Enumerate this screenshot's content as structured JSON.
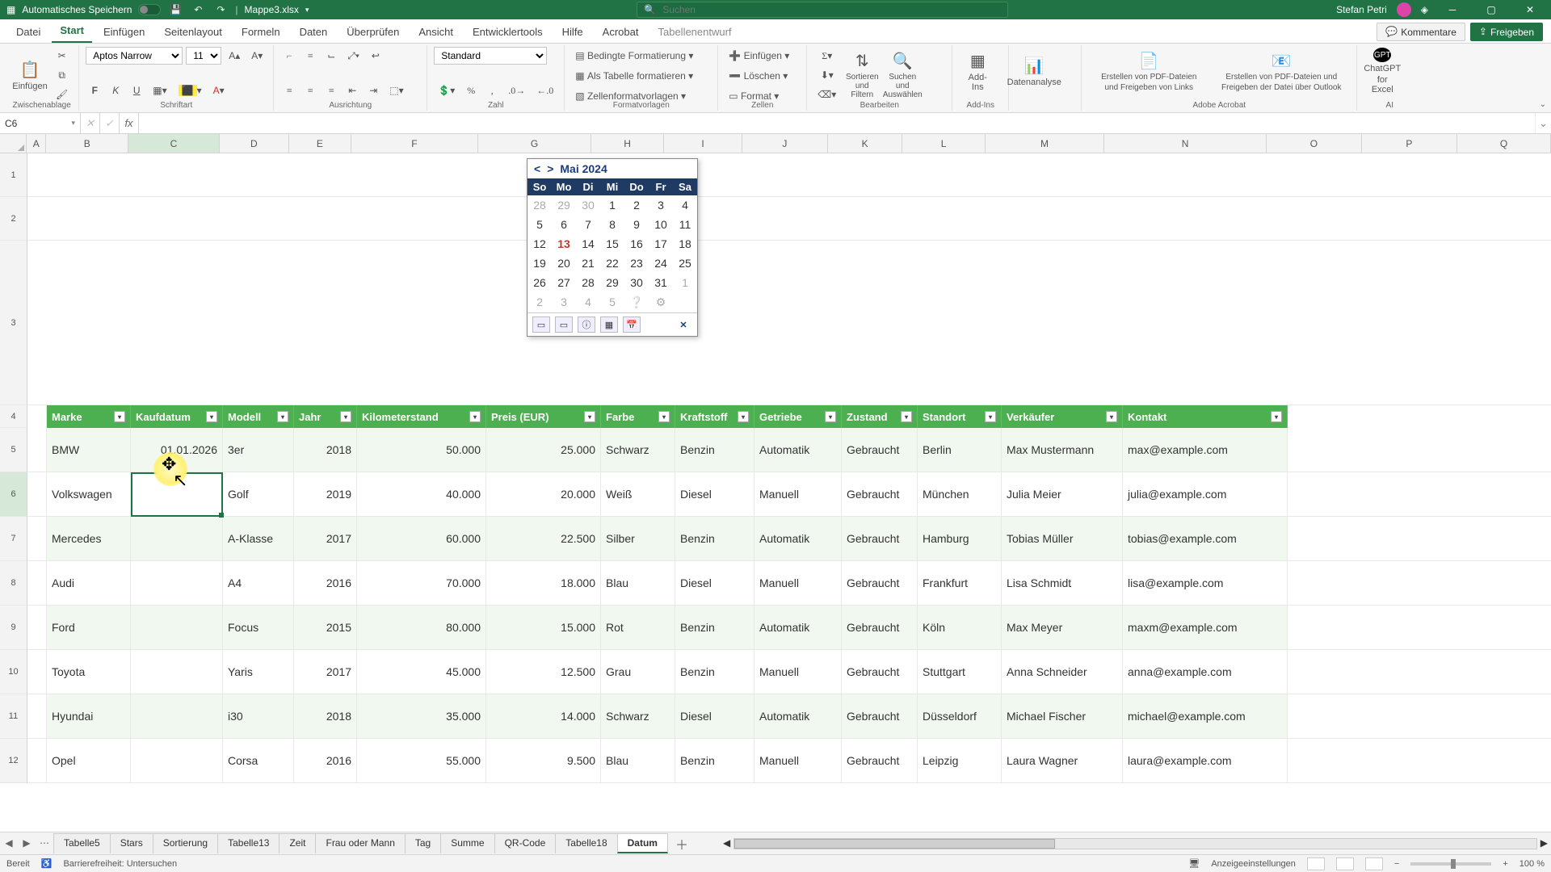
{
  "titlebar": {
    "autosave_label": "Automatisches Speichern",
    "filename": "Mappe3.xlsx",
    "search_placeholder": "Suchen",
    "user_name": "Stefan Petri"
  },
  "tabs": {
    "items": [
      "Datei",
      "Start",
      "Einfügen",
      "Seitenlayout",
      "Formeln",
      "Daten",
      "Überprüfen",
      "Ansicht",
      "Entwicklertools",
      "Hilfe",
      "Acrobat",
      "Tabellenentwurf"
    ],
    "active_index": 1,
    "comments": "Kommentare",
    "share": "Freigeben"
  },
  "ribbon": {
    "clipboard": {
      "paste": "Einfügen",
      "group": "Zwischenablage"
    },
    "font": {
      "name": "Aptos Narrow",
      "size": "11",
      "group": "Schriftart"
    },
    "alignment": {
      "group": "Ausrichtung"
    },
    "number": {
      "format": "Standard",
      "group": "Zahl"
    },
    "styles": {
      "cond": "Bedingte Formatierung",
      "astable": "Als Tabelle formatieren",
      "cellstyles": "Zellenformatvorlagen",
      "group": "Formatvorlagen"
    },
    "cells": {
      "insert": "Einfügen",
      "delete": "Löschen",
      "format": "Format",
      "group": "Zellen"
    },
    "editing": {
      "sort": "Sortieren und Filtern",
      "find": "Suchen und Auswählen",
      "group": "Bearbeiten"
    },
    "addins": {
      "btn": "Add-Ins",
      "group": "Add-Ins"
    },
    "analysis": {
      "btn": "Datenanalyse"
    },
    "acrobat": {
      "btn1a": "Erstellen von PDF-Dateien",
      "btn1b": "und Freigeben von Links",
      "btn2a": "Erstellen von PDF-Dateien und",
      "btn2b": "Freigeben der Datei über Outlook",
      "group": "Adobe Acrobat"
    },
    "ai": {
      "btn1": "ChatGPT",
      "btn2": "for Excel",
      "group": "AI"
    }
  },
  "namebox": "C6",
  "columns": [
    "A",
    "B",
    "C",
    "D",
    "E",
    "F",
    "G",
    "H",
    "I",
    "J",
    "K",
    "L",
    "M",
    "N",
    "O",
    "P",
    "Q"
  ],
  "row_numbers": [
    "1",
    "2",
    "3",
    "4",
    "5",
    "6",
    "7",
    "8",
    "9",
    "10",
    "11",
    "12"
  ],
  "calendar": {
    "title": "Mai 2024",
    "dow": [
      "So",
      "Mo",
      "Di",
      "Mi",
      "Do",
      "Fr",
      "Sa"
    ],
    "leading": [
      "28",
      "29",
      "30"
    ],
    "days": [
      "1",
      "2",
      "3",
      "4",
      "5",
      "6",
      "7",
      "8",
      "9",
      "10",
      "11",
      "12",
      "13",
      "14",
      "15",
      "16",
      "17",
      "18",
      "19",
      "20",
      "21",
      "22",
      "23",
      "24",
      "25",
      "26",
      "27",
      "28",
      "29",
      "30",
      "31"
    ],
    "trailing": [
      "1",
      "2",
      "3",
      "4",
      "5"
    ],
    "today": "13"
  },
  "table": {
    "headers": [
      "Marke",
      "Kaufdatum",
      "Modell",
      "Jahr",
      "Kilometerstand",
      "Preis (EUR)",
      "Farbe",
      "Kraftstoff",
      "Getriebe",
      "Zustand",
      "Standort",
      "Verkäufer",
      "Kontakt"
    ],
    "rows": [
      {
        "marke": "BMW",
        "kauf": "01.01.2026",
        "modell": "3er",
        "jahr": "2018",
        "km": "50.000",
        "preis": "25.000",
        "farbe": "Schwarz",
        "kraft": "Benzin",
        "getr": "Automatik",
        "zust": "Gebraucht",
        "ort": "Berlin",
        "verk": "Max Mustermann",
        "kontakt": "max@example.com"
      },
      {
        "marke": "Volkswagen",
        "kauf": "",
        "modell": "Golf",
        "jahr": "2019",
        "km": "40.000",
        "preis": "20.000",
        "farbe": "Weiß",
        "kraft": "Diesel",
        "getr": "Manuell",
        "zust": "Gebraucht",
        "ort": "München",
        "verk": "Julia Meier",
        "kontakt": "julia@example.com"
      },
      {
        "marke": "Mercedes",
        "kauf": "",
        "modell": "A-Klasse",
        "jahr": "2017",
        "km": "60.000",
        "preis": "22.500",
        "farbe": "Silber",
        "kraft": "Benzin",
        "getr": "Automatik",
        "zust": "Gebraucht",
        "ort": "Hamburg",
        "verk": "Tobias Müller",
        "kontakt": "tobias@example.com"
      },
      {
        "marke": "Audi",
        "kauf": "",
        "modell": "A4",
        "jahr": "2016",
        "km": "70.000",
        "preis": "18.000",
        "farbe": "Blau",
        "kraft": "Diesel",
        "getr": "Manuell",
        "zust": "Gebraucht",
        "ort": "Frankfurt",
        "verk": "Lisa Schmidt",
        "kontakt": "lisa@example.com"
      },
      {
        "marke": "Ford",
        "kauf": "",
        "modell": "Focus",
        "jahr": "2015",
        "km": "80.000",
        "preis": "15.000",
        "farbe": "Rot",
        "kraft": "Benzin",
        "getr": "Automatik",
        "zust": "Gebraucht",
        "ort": "Köln",
        "verk": "Max Meyer",
        "kontakt": "maxm@example.com"
      },
      {
        "marke": "Toyota",
        "kauf": "",
        "modell": "Yaris",
        "jahr": "2017",
        "km": "45.000",
        "preis": "12.500",
        "farbe": "Grau",
        "kraft": "Benzin",
        "getr": "Manuell",
        "zust": "Gebraucht",
        "ort": "Stuttgart",
        "verk": "Anna Schneider",
        "kontakt": "anna@example.com"
      },
      {
        "marke": "Hyundai",
        "kauf": "",
        "modell": "i30",
        "jahr": "2018",
        "km": "35.000",
        "preis": "14.000",
        "farbe": "Schwarz",
        "kraft": "Diesel",
        "getr": "Automatik",
        "zust": "Gebraucht",
        "ort": "Düsseldorf",
        "verk": "Michael Fischer",
        "kontakt": "michael@example.com"
      },
      {
        "marke": "Opel",
        "kauf": "",
        "modell": "Corsa",
        "jahr": "2016",
        "km": "55.000",
        "preis": "9.500",
        "farbe": "Blau",
        "kraft": "Benzin",
        "getr": "Manuell",
        "zust": "Gebraucht",
        "ort": "Leipzig",
        "verk": "Laura Wagner",
        "kontakt": "laura@example.com"
      }
    ]
  },
  "sheets": {
    "items": [
      "Tabelle5",
      "Stars",
      "Sortierung",
      "Tabelle13",
      "Zeit",
      "Frau oder Mann",
      "Tag",
      "Summe",
      "QR-Code",
      "Tabelle18",
      "Datum"
    ],
    "active_index": 10
  },
  "status": {
    "ready": "Bereit",
    "access": "Barrierefreiheit: Untersuchen",
    "display": "Anzeigeeinstellungen",
    "zoom": "100 %"
  }
}
